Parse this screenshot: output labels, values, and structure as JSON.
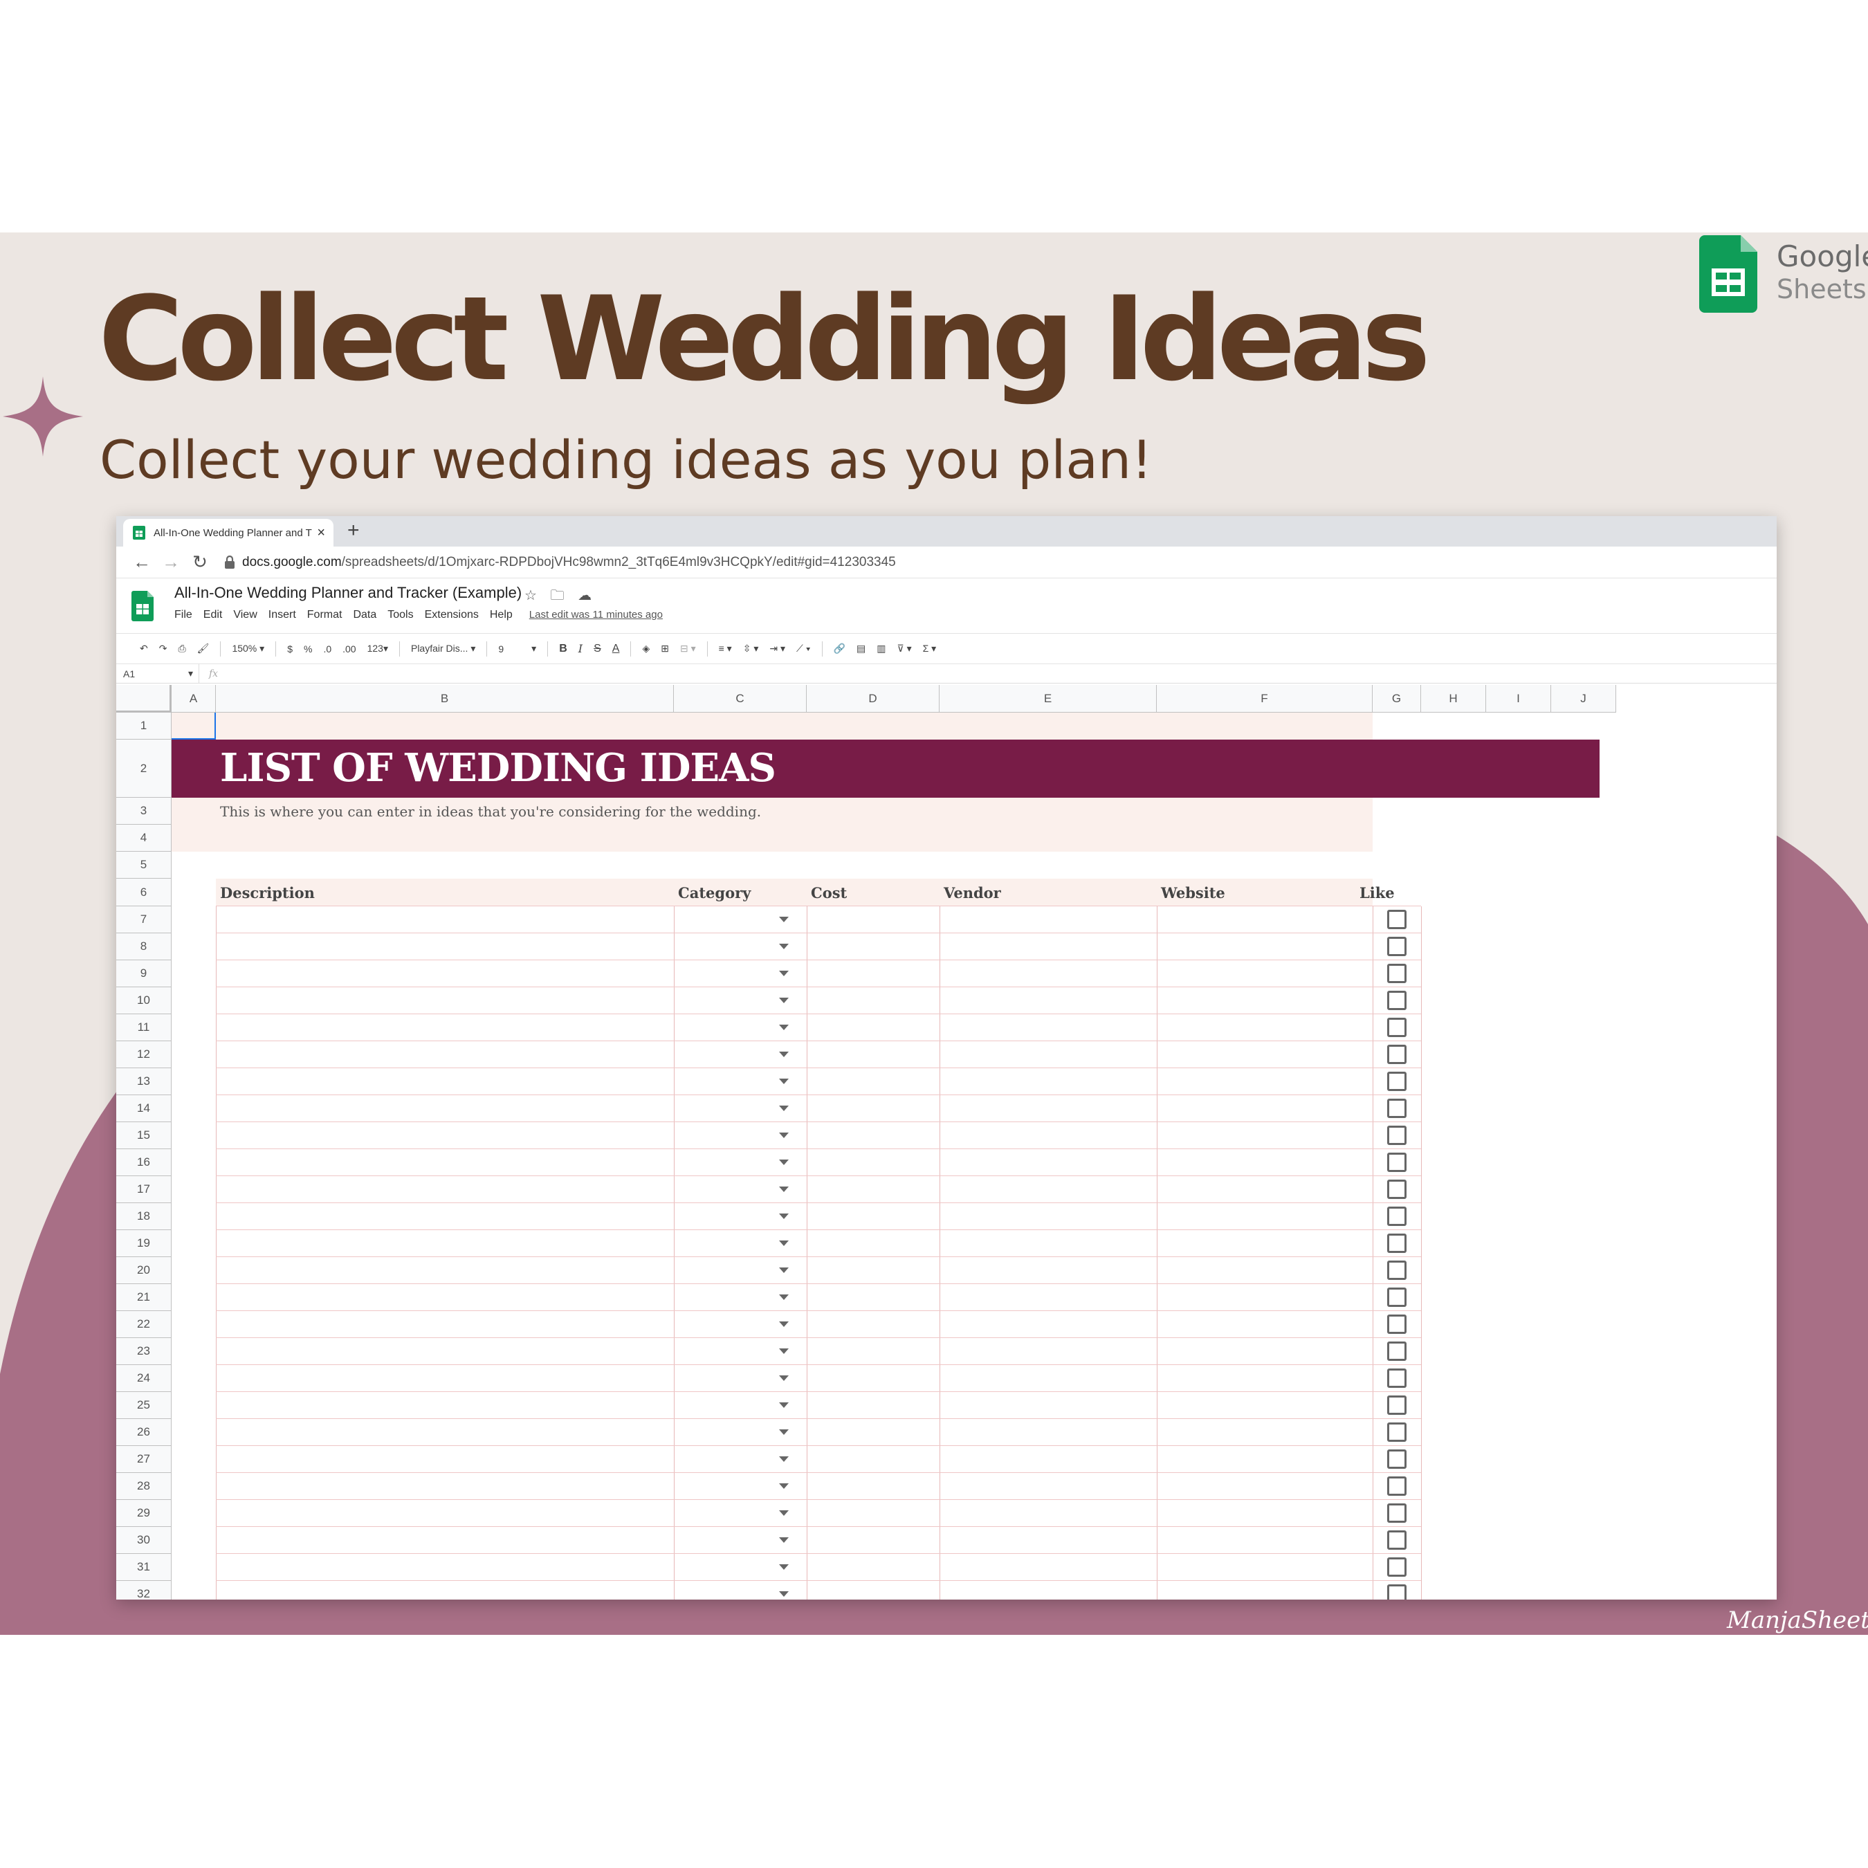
{
  "promo": {
    "headline": "Collect Wedding Ideas",
    "subheadline": "Collect your wedding ideas as you plan!",
    "brand_word1": "Google",
    "brand_word2": "Sheets",
    "signature": "ManjaSheets"
  },
  "browser": {
    "tab_title": "All-In-One Wedding Planner and T",
    "new_tab": "+",
    "close": "×",
    "url_host": "docs.google.com",
    "url_path": "/spreadsheets/d/1Omjxarc-RDPDbojVHc98wmn2_3tTq6E4ml9v3HCQpkY/edit#gid=412303345"
  },
  "doc": {
    "title": "All-In-One Wedding Planner and Tracker (Example)",
    "menu": [
      "File",
      "Edit",
      "View",
      "Insert",
      "Format",
      "Data",
      "Tools",
      "Extensions",
      "Help"
    ],
    "last_edit": "Last edit was 11 minutes ago"
  },
  "toolbar": {
    "zoom": "150%",
    "currency": "$",
    "percent": "%",
    "dec_less": ".0",
    "dec_more": ".00",
    "format_more": "123",
    "font": "Playfair Dis...",
    "font_size": "9",
    "bold": "B",
    "italic": "I",
    "strike": "S",
    "text_color": "A",
    "sum": "Σ"
  },
  "formula_bar": {
    "cell_ref": "A1",
    "fx": "fx"
  },
  "sheet": {
    "columns": [
      "A",
      "B",
      "C",
      "D",
      "E",
      "F",
      "G",
      "H",
      "I",
      "J"
    ],
    "rows": [
      "1",
      "2",
      "3",
      "4",
      "5",
      "6",
      "7",
      "8",
      "9",
      "10",
      "11",
      "12",
      "13",
      "14",
      "15",
      "16",
      "17",
      "18",
      "19",
      "20",
      "21",
      "22",
      "23",
      "24",
      "25",
      "26",
      "27",
      "28",
      "29",
      "30",
      "31",
      "32"
    ],
    "title": "LIST OF WEDDING IDEAS",
    "description": "This is where you can enter in ideas that you're considering for the wedding.",
    "table_headers": {
      "description": "Description",
      "category": "Category",
      "cost": "Cost",
      "vendor": "Vendor",
      "website": "Website",
      "like": "Like"
    },
    "data_row_count": 26,
    "checkboxes_checked": false
  },
  "colors": {
    "headline": "#5e3b23",
    "banner_bg": "#ece6e2",
    "mauve_blob": "#a86f86",
    "title_bar": "#781c47",
    "pink_fill": "#fbf0ec",
    "sheets_green": "#0f9d58"
  }
}
